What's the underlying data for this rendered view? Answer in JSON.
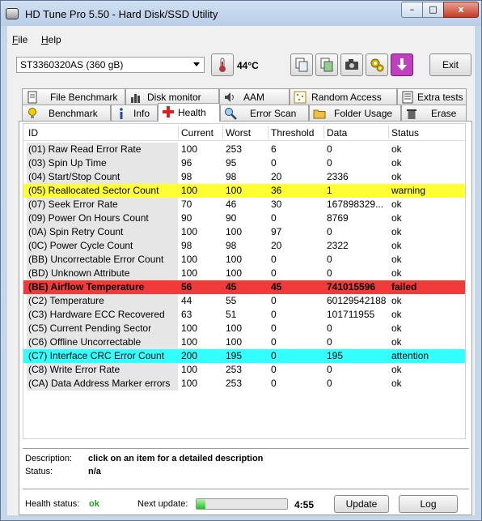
{
  "window": {
    "title": "HD Tune Pro 5.50 - Hard Disk/SSD Utility",
    "min": "–",
    "max": "□",
    "close": "x"
  },
  "menu": [
    {
      "first": "F",
      "rest": "ile"
    },
    {
      "first": "H",
      "rest": "elp"
    }
  ],
  "drive": {
    "selected": "ST3360320AS (360 gB)"
  },
  "temperature": "44°C",
  "exit_label": "Exit",
  "tabs_top": [
    "File Benchmark",
    "Disk monitor",
    "AAM",
    "Random Access",
    "Extra tests"
  ],
  "tabs_bottom": [
    "Benchmark",
    "Info",
    "Health",
    "Error Scan",
    "Folder Usage",
    "Erase"
  ],
  "active_tab": "Health",
  "columns": [
    "ID",
    "Current",
    "Worst",
    "Threshold",
    "Data",
    "Status"
  ],
  "rows": [
    {
      "id": "(01) Raw Read Error Rate",
      "current": "100",
      "worst": "253",
      "threshold": "6",
      "data": "0",
      "status": "ok",
      "hl": ""
    },
    {
      "id": "(03) Spin Up Time",
      "current": "96",
      "worst": "95",
      "threshold": "0",
      "data": "0",
      "status": "ok",
      "hl": ""
    },
    {
      "id": "(04) Start/Stop Count",
      "current": "98",
      "worst": "98",
      "threshold": "20",
      "data": "2336",
      "status": "ok",
      "hl": ""
    },
    {
      "id": "(05) Reallocated Sector Count",
      "current": "100",
      "worst": "100",
      "threshold": "36",
      "data": "1",
      "status": "warning",
      "hl": "yellow"
    },
    {
      "id": "(07) Seek Error Rate",
      "current": "70",
      "worst": "46",
      "threshold": "30",
      "data": "167898329...",
      "status": "ok",
      "hl": ""
    },
    {
      "id": "(09) Power On Hours Count",
      "current": "90",
      "worst": "90",
      "threshold": "0",
      "data": "8769",
      "status": "ok",
      "hl": ""
    },
    {
      "id": "(0A) Spin Retry Count",
      "current": "100",
      "worst": "100",
      "threshold": "97",
      "data": "0",
      "status": "ok",
      "hl": ""
    },
    {
      "id": "(0C) Power Cycle Count",
      "current": "98",
      "worst": "98",
      "threshold": "20",
      "data": "2322",
      "status": "ok",
      "hl": ""
    },
    {
      "id": "(BB) Uncorrectable Error Count",
      "current": "100",
      "worst": "100",
      "threshold": "0",
      "data": "0",
      "status": "ok",
      "hl": ""
    },
    {
      "id": "(BD) Unknown Attribute",
      "current": "100",
      "worst": "100",
      "threshold": "0",
      "data": "0",
      "status": "ok",
      "hl": ""
    },
    {
      "id": "(BE) Airflow Temperature",
      "current": "56",
      "worst": "45",
      "threshold": "45",
      "data": "741015596",
      "status": "failed",
      "hl": "red"
    },
    {
      "id": "(C2) Temperature",
      "current": "44",
      "worst": "55",
      "threshold": "0",
      "data": "60129542188",
      "status": "ok",
      "hl": ""
    },
    {
      "id": "(C3) Hardware ECC Recovered",
      "current": "63",
      "worst": "51",
      "threshold": "0",
      "data": "101711955",
      "status": "ok",
      "hl": ""
    },
    {
      "id": "(C5) Current Pending Sector",
      "current": "100",
      "worst": "100",
      "threshold": "0",
      "data": "0",
      "status": "ok",
      "hl": ""
    },
    {
      "id": "(C6) Offline Uncorrectable",
      "current": "100",
      "worst": "100",
      "threshold": "0",
      "data": "0",
      "status": "ok",
      "hl": ""
    },
    {
      "id": "(C7) Interface CRC Error Count",
      "current": "200",
      "worst": "195",
      "threshold": "0",
      "data": "195",
      "status": "attention",
      "hl": "cyan"
    },
    {
      "id": "(C8) Write Error Rate",
      "current": "100",
      "worst": "253",
      "threshold": "0",
      "data": "0",
      "status": "ok",
      "hl": ""
    },
    {
      "id": "(CA) Data Address Marker errors",
      "current": "100",
      "worst": "253",
      "threshold": "0",
      "data": "0",
      "status": "ok",
      "hl": ""
    }
  ],
  "description": {
    "label": "Description:",
    "value": "click on an item for a detailed description"
  },
  "status": {
    "label": "Status:",
    "value": "n/a"
  },
  "health_status": {
    "label": "Health status:",
    "value": "ok"
  },
  "next_update": {
    "label": "Next update:",
    "countdown": "4:55",
    "progress": 0.1
  },
  "buttons": {
    "update": "Update",
    "log": "Log"
  },
  "colors": {
    "warning": "#ffff33",
    "failed": "#f23a3a",
    "attention": "#33ffff",
    "ok_text": "#1aa31a"
  }
}
